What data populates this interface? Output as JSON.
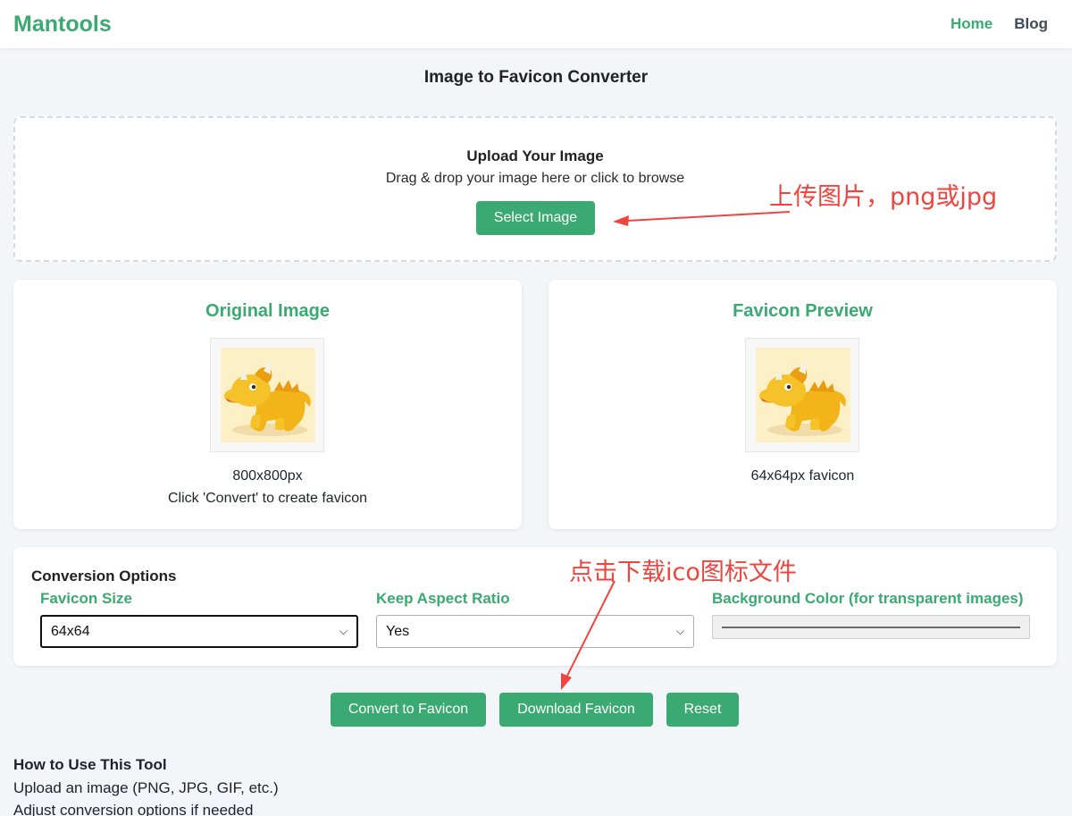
{
  "nav": {
    "logo": "Mantools",
    "links": [
      {
        "label": "Home",
        "active": true
      },
      {
        "label": "Blog",
        "active": false
      }
    ]
  },
  "page_title": "Image to Favicon Converter",
  "upload": {
    "title": "Upload Your Image",
    "subtitle": "Drag & drop your image here or click to browse",
    "button_label": "Select Image"
  },
  "original": {
    "heading": "Original Image",
    "image_icon": "dinosaur-toy-image",
    "dimensions": "800x800px",
    "hint": "Click 'Convert' to create favicon"
  },
  "preview": {
    "heading": "Favicon Preview",
    "image_icon": "dinosaur-toy-image",
    "caption": "64x64px favicon"
  },
  "options": {
    "heading": "Conversion Options",
    "size": {
      "label": "Favicon Size",
      "selected": "64x64"
    },
    "aspect": {
      "label": "Keep Aspect Ratio",
      "selected": "Yes"
    },
    "background": {
      "label": "Background Color (for transparent images)"
    }
  },
  "actions": {
    "convert": "Convert to Favicon",
    "download": "Download Favicon",
    "reset": "Reset"
  },
  "howto": {
    "title": "How to Use This Tool",
    "steps": [
      "Upload an image (PNG, JPG, GIF, etc.)",
      "Adjust conversion options if needed"
    ]
  },
  "annotations": {
    "upload_note": "上传图片，png或jpg",
    "download_note": "点击下载ico图标文件"
  },
  "colors": {
    "accent": "#3aaa72",
    "annotation": "#f0443f",
    "background": "#f3f6f9"
  }
}
